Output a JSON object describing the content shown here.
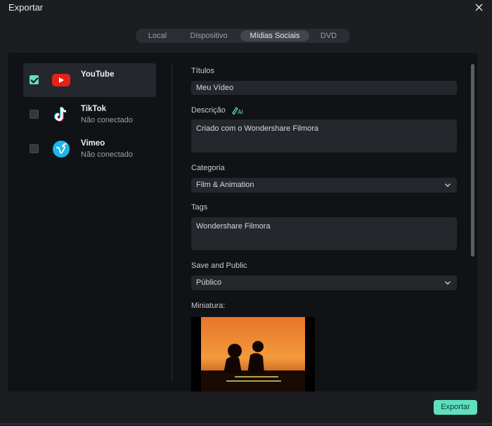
{
  "window": {
    "title": "Exportar"
  },
  "tabs": [
    {
      "label": "Local",
      "active": false
    },
    {
      "label": "Dispositivo",
      "active": false
    },
    {
      "label": "Mídias Sociais",
      "active": true
    },
    {
      "label": "DVD",
      "active": false
    }
  ],
  "platforms": [
    {
      "name": "YouTube",
      "status": "",
      "checked": true,
      "icon": "youtube-icon"
    },
    {
      "name": "TikTok",
      "status": "Não conectado",
      "checked": false,
      "icon": "tiktok-icon"
    },
    {
      "name": "Vimeo",
      "status": "Não conectado",
      "checked": false,
      "icon": "vimeo-icon"
    }
  ],
  "form": {
    "title_label": "Títulos",
    "title_value": "Meu Vídeo",
    "description_label": "Descrição",
    "description_value": "Criado com o Wondershare Filmora",
    "category_label": "Categoria",
    "category_value": "Film & Animation",
    "tags_label": "Tags",
    "tags_value": "Wondershare Filmora",
    "privacy_label": "Save and Public",
    "privacy_value": "Público",
    "thumbnail_label": "Miniatura:"
  },
  "export_button": {
    "label": "Exportar"
  },
  "colors": {
    "accent": "#5fe0bf",
    "background": "#1b1d21",
    "panel": "#101215"
  }
}
